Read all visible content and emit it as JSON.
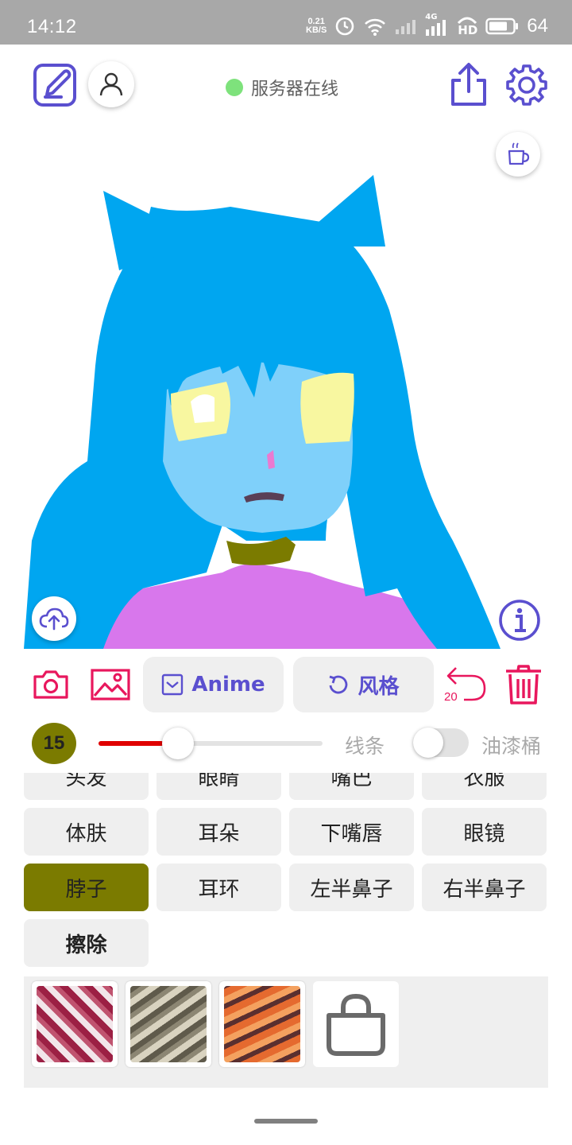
{
  "status_bar": {
    "time": "14:12",
    "net_speed_value": "0.21",
    "net_speed_unit": "KB/S",
    "network": "4G",
    "hd": "HD",
    "battery": "64"
  },
  "header": {
    "server_status": "服务器在线",
    "server_status_color": "#7ee27c"
  },
  "actions": {
    "anime_label": "Anime",
    "style_label": "风格",
    "undo_count": "20"
  },
  "brush": {
    "size": "15",
    "size_fraction": 0.29,
    "line_label": "线条",
    "bucket_label": "油漆桶",
    "bucket_enabled": false,
    "color": "#7b7b00"
  },
  "categories": [
    {
      "label": "头发"
    },
    {
      "label": "眼睛"
    },
    {
      "label": "嘴巴"
    },
    {
      "label": "衣服"
    },
    {
      "label": "体肤"
    },
    {
      "label": "耳朵"
    },
    {
      "label": "下嘴唇"
    },
    {
      "label": "眼镜"
    },
    {
      "label": "脖子",
      "selected": true
    },
    {
      "label": "耳环"
    },
    {
      "label": "左半鼻子"
    },
    {
      "label": "右半鼻子"
    },
    {
      "label": "擦除"
    }
  ],
  "colors": {
    "accent_purple": "#5a4fcf",
    "accent_red": "#e8175d",
    "hair": "#00a6f0",
    "skin": "#7fd0fa",
    "eyes": "#f8f7a0",
    "shirt": "#d877ec",
    "collar": "#7b7b00"
  },
  "icons": {
    "edit": "edit-icon",
    "user": "user-icon",
    "share": "share-icon",
    "settings": "gear-icon",
    "coffee": "coffee-icon",
    "upload": "cloud-upload-icon",
    "info": "info-icon",
    "camera": "camera-icon",
    "gallery": "image-icon",
    "undo": "undo-icon",
    "delete": "trash-icon",
    "shop": "shopping-bag-icon"
  }
}
